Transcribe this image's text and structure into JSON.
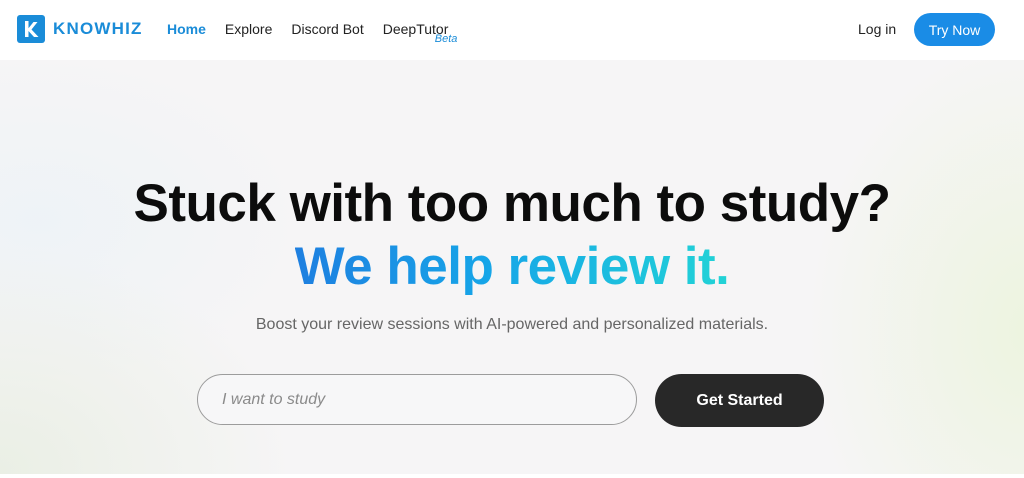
{
  "brand": {
    "name": "KNOWHIZ",
    "color": "#1a8cd8",
    "icon": "k-logo-icon"
  },
  "nav": {
    "items": [
      {
        "label": "Home",
        "active": true
      },
      {
        "label": "Explore",
        "active": false
      },
      {
        "label": "Discord Bot",
        "active": false
      },
      {
        "label": "DeepTutor",
        "active": false,
        "badge": "Beta"
      }
    ],
    "login_label": "Log in",
    "try_now_label": "Try Now"
  },
  "hero": {
    "title": "Stuck with too much to study?",
    "subtitle": "We help review it.",
    "description": "Boost your review sessions with AI-powered and personalized materials.",
    "input_placeholder": "I want to study",
    "input_value": "",
    "cta_label": "Get Started"
  },
  "colors": {
    "accent": "#1a8ce6",
    "gradient_start": "#1e7fe0",
    "gradient_end": "#22d3d6",
    "cta_background": "#282828"
  }
}
